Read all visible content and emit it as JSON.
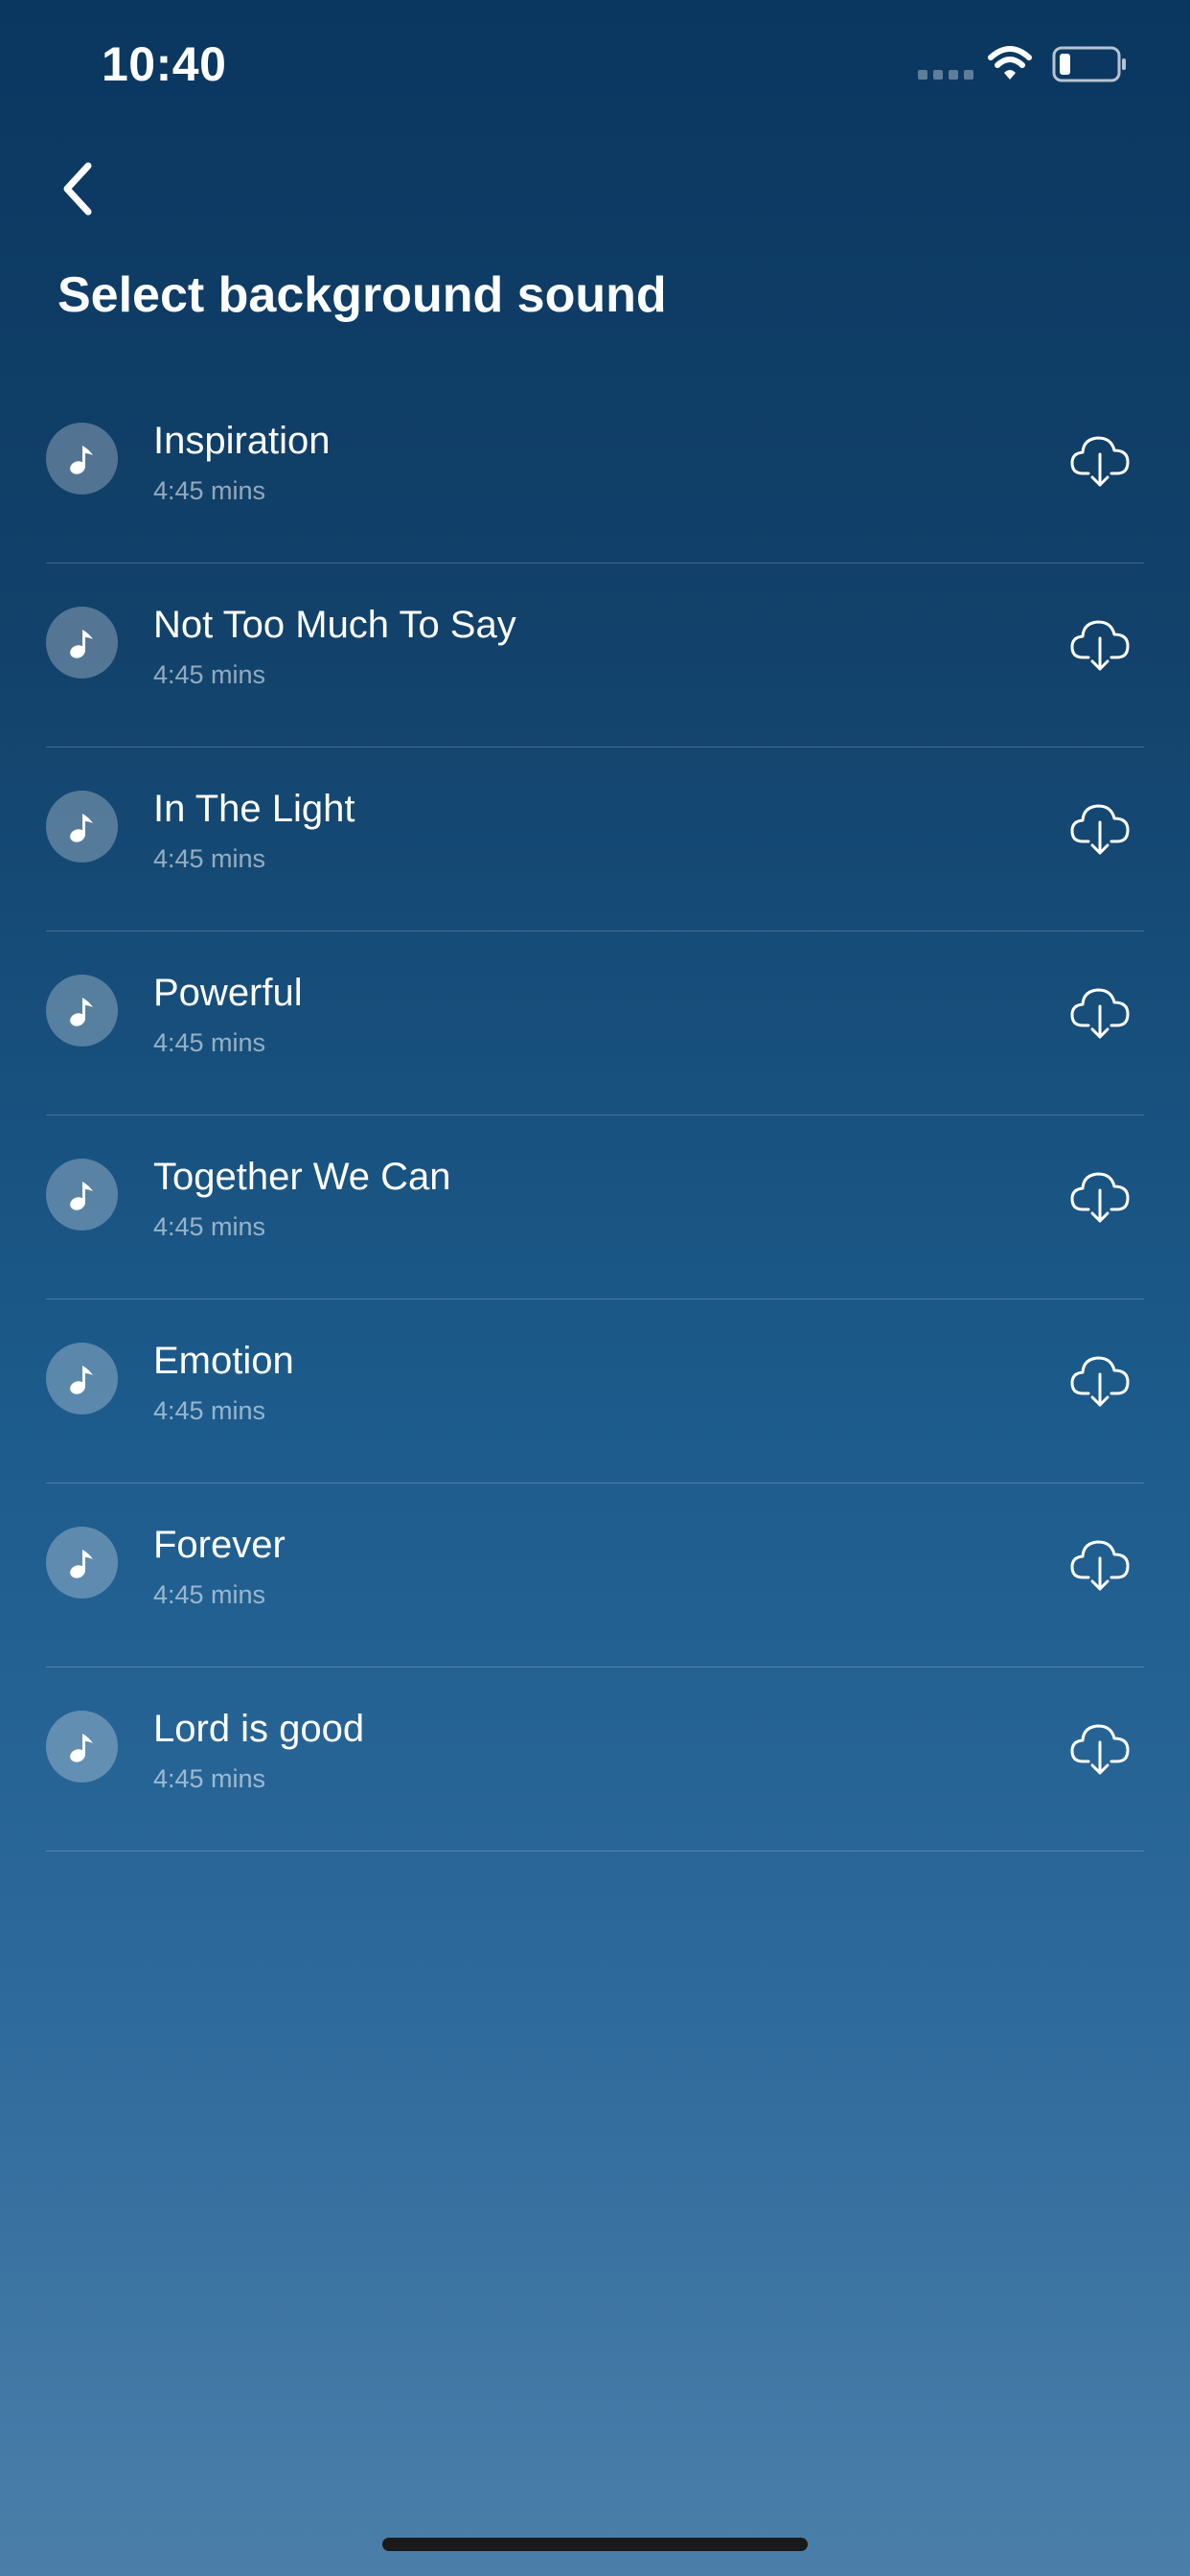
{
  "status_bar": {
    "time": "10:40"
  },
  "header": {
    "back_icon": "chevron-left-icon",
    "title": "Select background sound"
  },
  "sounds": [
    {
      "title": "Inspiration",
      "duration": "4:45 mins"
    },
    {
      "title": "Not Too Much To Say",
      "duration": "4:45 mins"
    },
    {
      "title": "In The Light",
      "duration": "4:45 mins"
    },
    {
      "title": "Powerful",
      "duration": "4:45 mins"
    },
    {
      "title": "Together We Can",
      "duration": "4:45 mins"
    },
    {
      "title": "Emotion",
      "duration": "4:45 mins"
    },
    {
      "title": "Forever",
      "duration": "4:45 mins"
    },
    {
      "title": "Lord is good",
      "duration": "4:45 mins"
    }
  ],
  "icons": {
    "item": "music-note-icon",
    "action": "cloud-download-icon"
  },
  "colors": {
    "background_top": "#0a3760",
    "background_bottom": "#4b7fa9",
    "text": "#ffffff"
  }
}
